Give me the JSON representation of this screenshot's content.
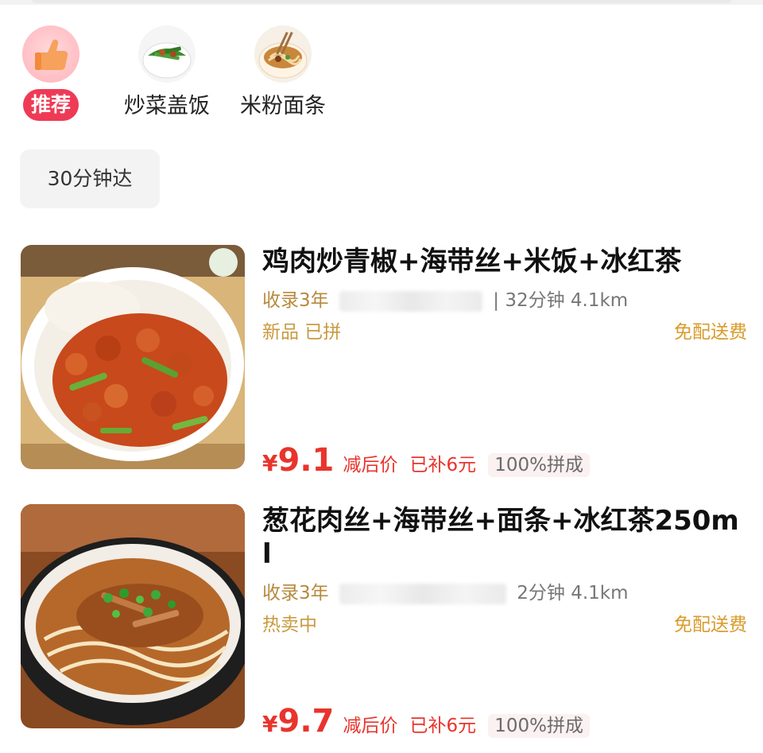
{
  "categories": [
    {
      "label": "推荐",
      "icon": "thumbs-up-icon",
      "selected": true
    },
    {
      "label": "炒菜盖饭",
      "icon": "stir-fry-rice-icon",
      "selected": false
    },
    {
      "label": "米粉面条",
      "icon": "noodles-icon",
      "selected": false
    }
  ],
  "filter_chip": "30分钟达",
  "items": [
    {
      "title": "鸡肉炒青椒+海带丝+米饭+冰红茶",
      "years": "收录3年",
      "blur_prefix": "",
      "time_distance": "| 32分钟  4.1km",
      "tags_left": "新品  已拼",
      "tags_right": "免配送费",
      "price_symbol": "¥",
      "price": "9.1",
      "after_label": "减后价",
      "subsidy": "已补6元",
      "group": "100%拼成"
    },
    {
      "title": "葱花肉丝+海带丝+面条+冰红茶250ml",
      "years": "收录3年",
      "blur_prefix": "",
      "time_distance": "2分钟  4.1km",
      "tags_left": "热卖中",
      "tags_right": "免配送费",
      "price_symbol": "¥",
      "price": "9.7",
      "after_label": "减后价",
      "subsidy": "已补6元",
      "group": "100%拼成"
    }
  ]
}
